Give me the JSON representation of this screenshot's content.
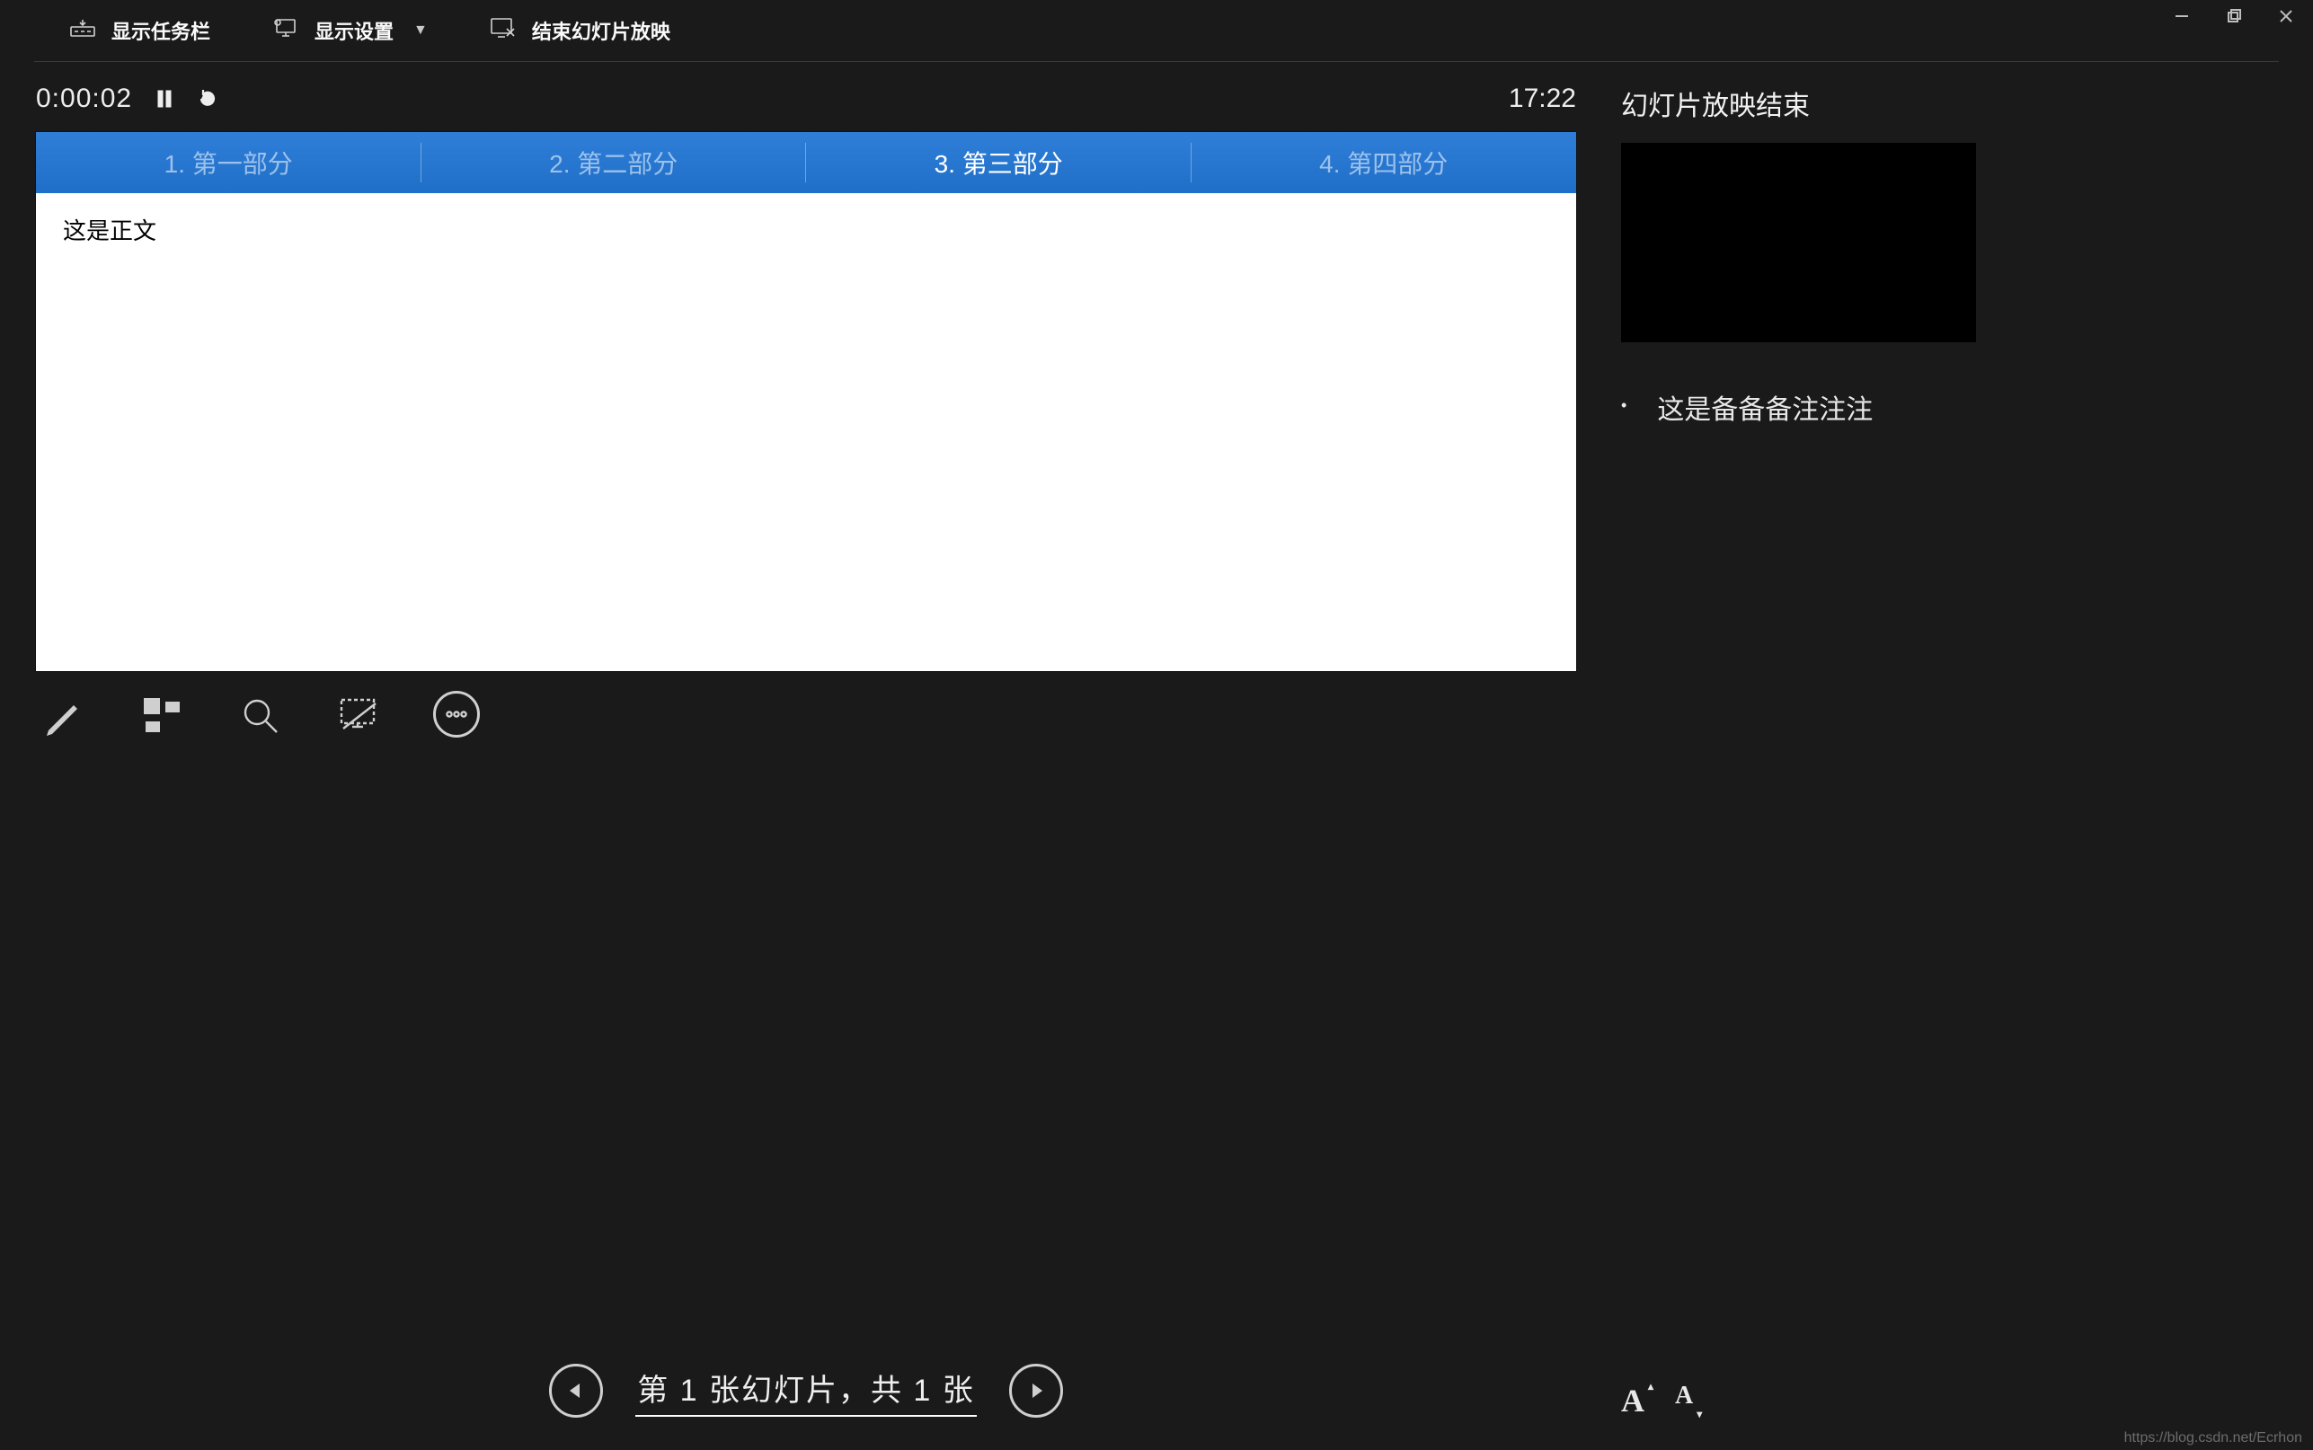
{
  "toolbar": {
    "show_taskbar": "显示任务栏",
    "display_settings": "显示设置",
    "end_slideshow": "结束幻灯片放映"
  },
  "timer": {
    "elapsed": "0:00:02",
    "clock": "17:22"
  },
  "slide": {
    "tabs": [
      {
        "label": "1. 第一部分",
        "active": false
      },
      {
        "label": "2. 第二部分",
        "active": false
      },
      {
        "label": "3. 第三部分",
        "active": true
      },
      {
        "label": "4. 第四部分",
        "active": false
      }
    ],
    "body_text": "这是正文"
  },
  "right": {
    "next_slide_title": "幻灯片放映结束",
    "notes_text": "这是备备备注注注"
  },
  "nav": {
    "counter": "第 1 张幻灯片，共 1 张"
  },
  "watermark": "https://blog.csdn.net/Ecrhon"
}
